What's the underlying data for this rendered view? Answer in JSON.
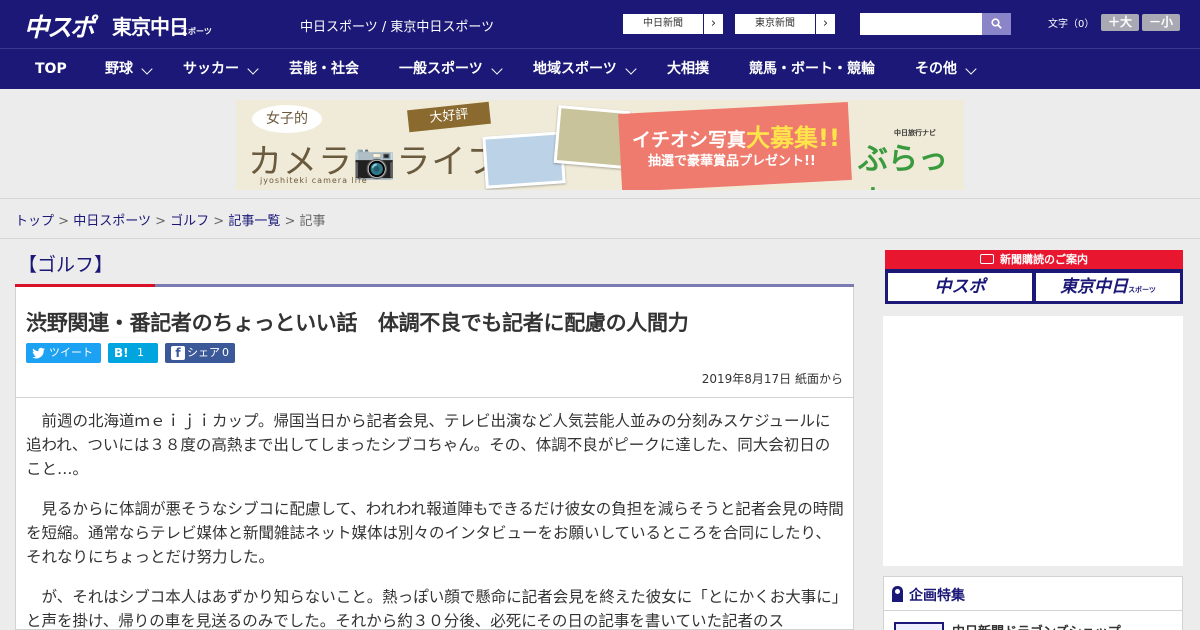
{
  "header": {
    "logo_main": "中スポ",
    "logo_tokyo": "東京中日",
    "logo_tokyo_small": "スポーツ",
    "site_links": "中日スポーツ / 東京中日スポーツ",
    "ext_links": [
      "中日新聞",
      "東京新聞"
    ],
    "search": {
      "placeholder": "",
      "value": ""
    },
    "font_size_label": "文字（0）",
    "font_bigger": "＋大",
    "font_smaller": "－小"
  },
  "nav": {
    "items": [
      {
        "label": "TOP",
        "has_dropdown": false
      },
      {
        "label": "野球",
        "has_dropdown": true
      },
      {
        "label": "サッカー",
        "has_dropdown": true
      },
      {
        "label": "芸能・社会",
        "has_dropdown": false
      },
      {
        "label": "一般スポーツ",
        "has_dropdown": true
      },
      {
        "label": "地域スポーツ",
        "has_dropdown": true
      },
      {
        "label": "大相撲",
        "has_dropdown": false
      },
      {
        "label": "競馬・ボート・競輪",
        "has_dropdown": false
      },
      {
        "label": "その他",
        "has_dropdown": true
      }
    ]
  },
  "banner": {
    "girl": "女子的",
    "title": "カメラ📷ライフ",
    "subtitle": "jyoshiteki camera life",
    "ribbon": "大好評",
    "headline_pre": "イチオシ写真",
    "headline_big": "大募集",
    "headline_post": "!!",
    "prize": "抽選で豪華賞品プレゼント!!",
    "brand_small": "中日旅行ナビ",
    "brand": "ぶらっ人"
  },
  "breadcrumb": {
    "items": [
      "トップ",
      "中日スポーツ",
      "ゴルフ",
      "記事一覧"
    ],
    "current": "記事",
    "separator": ">"
  },
  "article": {
    "category": "【ゴルフ】",
    "title": "渋野関連・番記者のちょっといい話　体調不良でも記者に配慮の人間力",
    "share": {
      "tweet": "ツイート",
      "hatena_icon": "B!",
      "hatena_count": "1",
      "facebook_icon": "f",
      "facebook_label": "シェア",
      "facebook_count": "0"
    },
    "date": "2019年8月17日 紙面から",
    "paragraphs": [
      "　前週の北海道ｍｅｉｊｉカップ。帰国当日から記者会見、テレビ出演など人気芸能人並みの分刻みスケジュールに追われ、ついには３８度の高熱まで出してしまったシブコちゃん。その、体調不良がピークに達した、同大会初日のこと…。",
      "　見るからに体調が悪そうなシブコに配慮して、われわれ報道陣もできるだけ彼女の負担を減らそうと記者会見の時間を短縮。通常ならテレビ媒体と新聞雑誌ネット媒体は別々のインタビューをお願いしているところを合同にしたり、それなりにちょっとだけ努力した。",
      "　が、それはシブコ本人はあずかり知らないこと。熱っぽい顔で懸命に記者会見を終えた彼女に「とにかくお大事に」と声を掛け、帰りの車を見送るのみでした。それから約３０分後、必死にその日の記事を書いていた記者のス"
    ]
  },
  "sidebar": {
    "subscription": {
      "heading": "新聞購読のご案内",
      "btn_chunichi": "中スポ",
      "btn_tokyo": "東京中日",
      "btn_tokyo_small": "スポーツ"
    },
    "feature": {
      "heading": "企画特集",
      "first_item": "中日新聞ドラゴンズショップ"
    }
  },
  "colors": {
    "navy": "#1b1877",
    "accent_red": "#e8162e",
    "twitter": "#1da1f2",
    "hatena": "#00a4de",
    "facebook": "#3b5998"
  }
}
